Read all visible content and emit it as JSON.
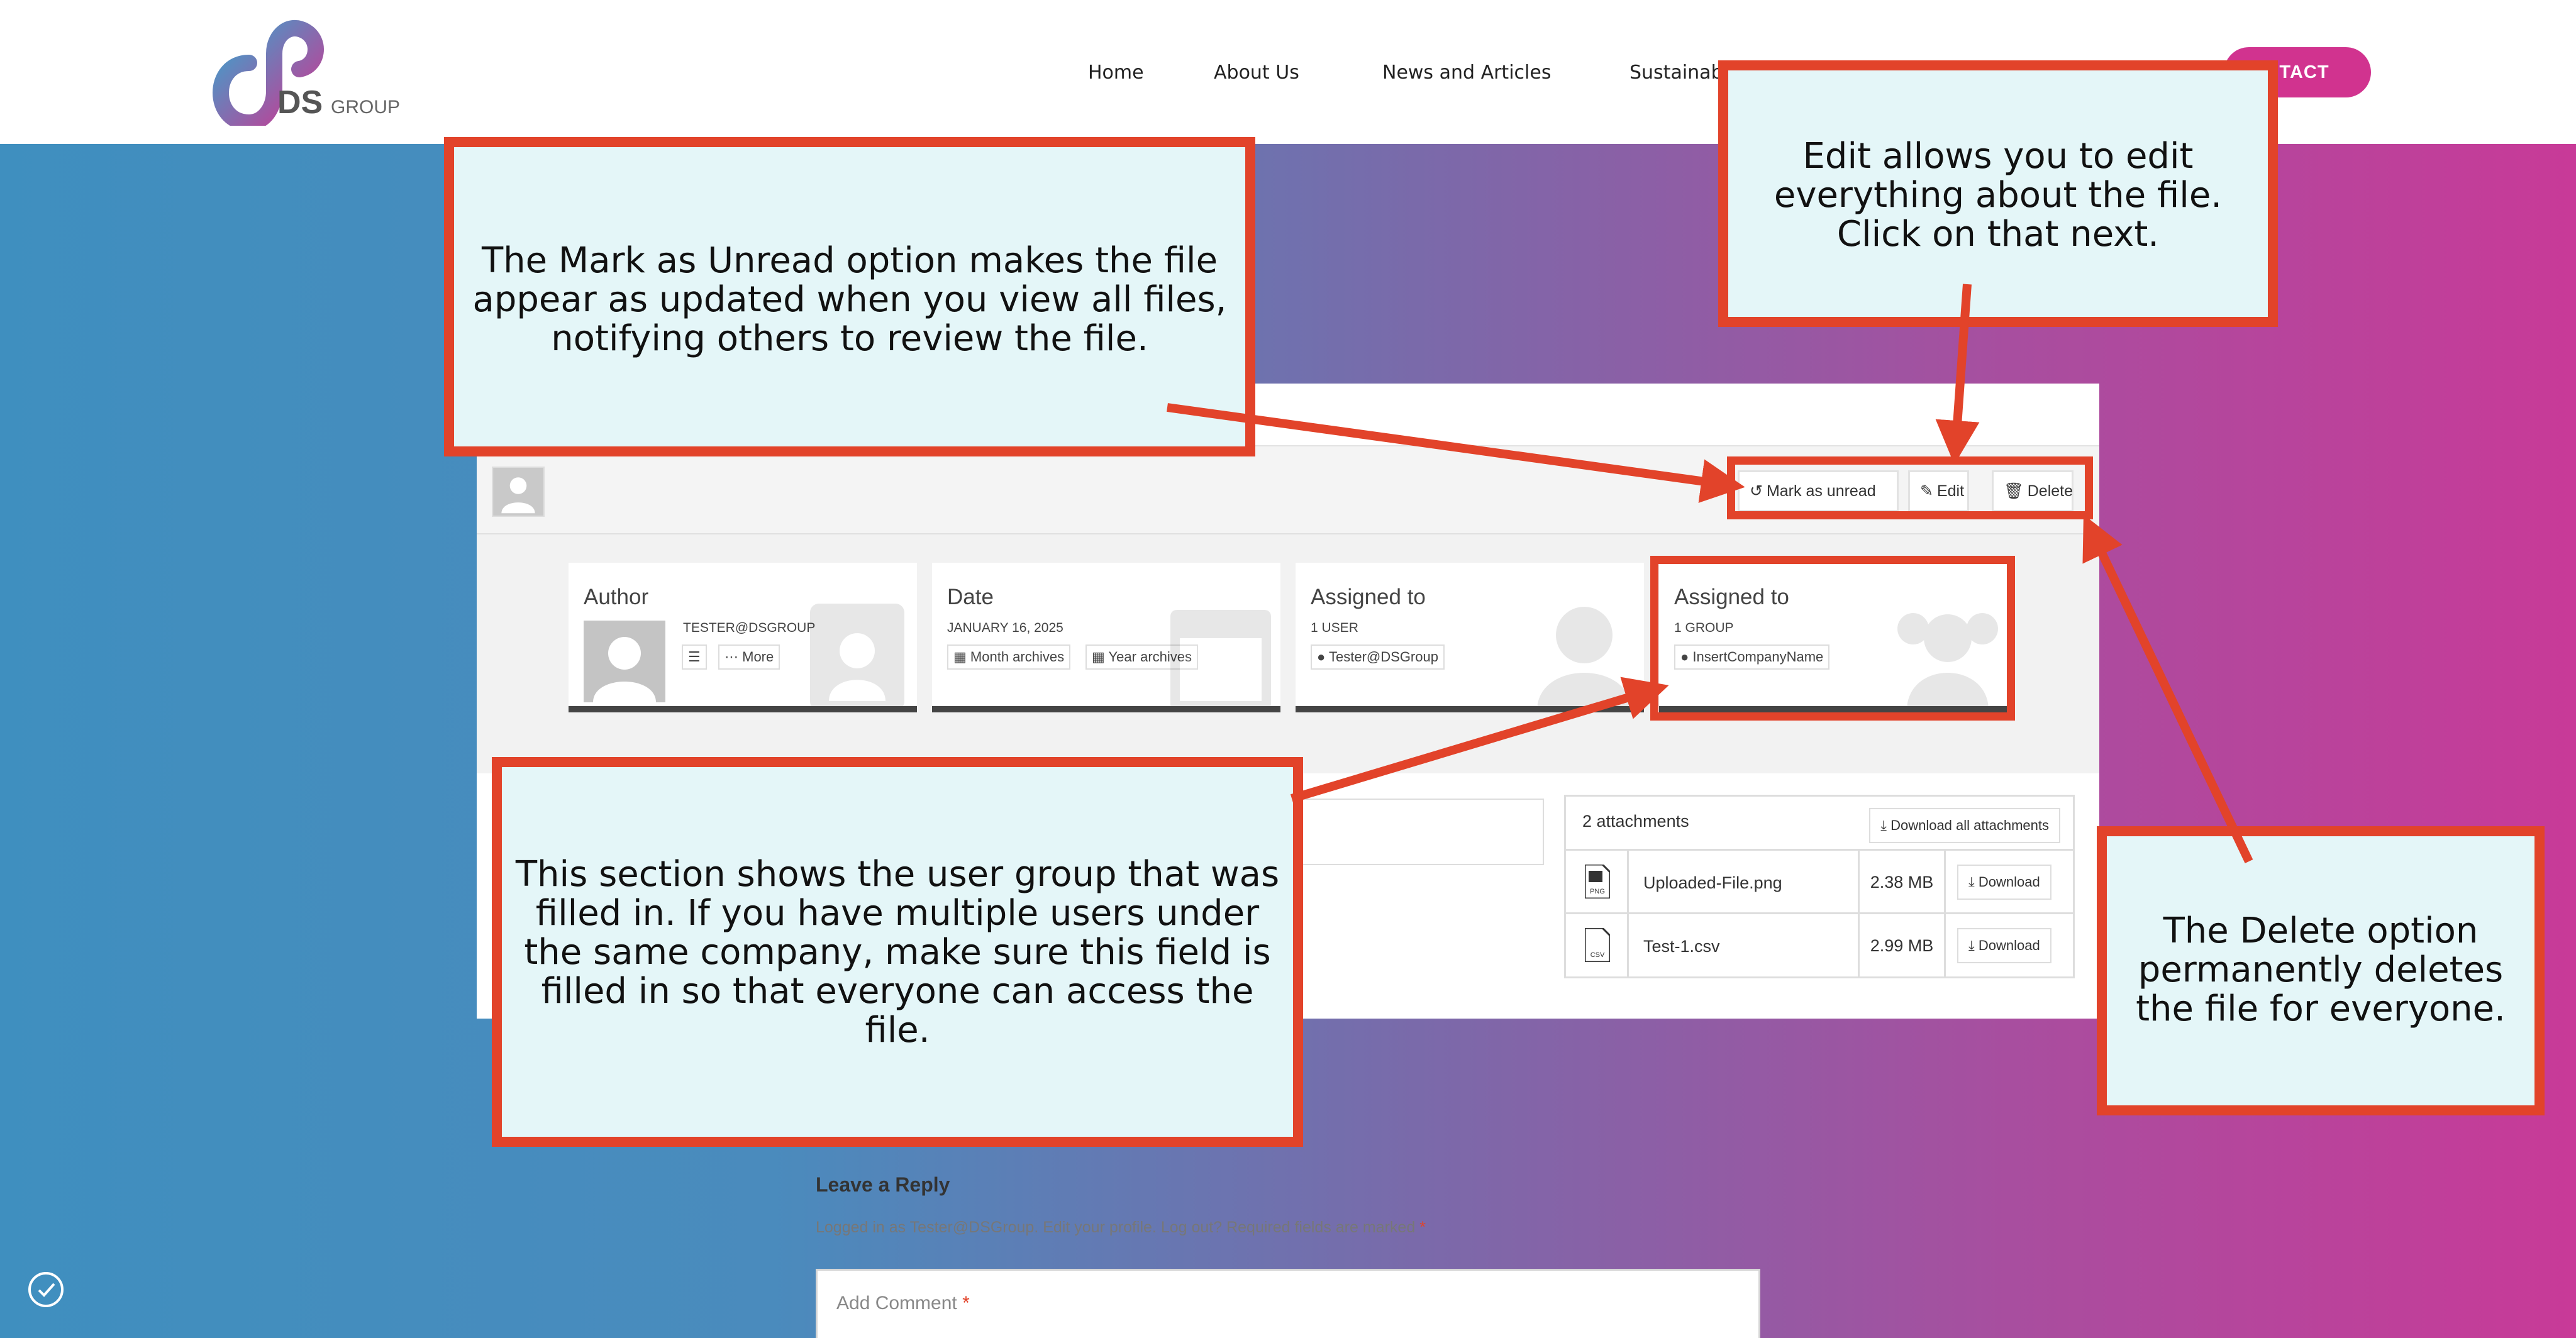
{
  "header": {
    "logo_text": "DS",
    "logo_sub": "GROUP",
    "nav": [
      {
        "label": "Home"
      },
      {
        "label": "About Us"
      },
      {
        "label": "News and Articles"
      },
      {
        "label": "Sustainab"
      }
    ],
    "contact_label": "NTACT"
  },
  "file": {
    "toolbar": {
      "mark_unread": "Mark as unread",
      "edit": "Edit",
      "delete": "Delete"
    },
    "author": {
      "title": "Author",
      "name": "TESTER@DSGROUP",
      "more": "More"
    },
    "date": {
      "title": "Date",
      "value": "JANUARY 16, 2025",
      "month_archives": "Month archives",
      "year_archives": "Year archives"
    },
    "assigned_user": {
      "title": "Assigned to",
      "count": "1 USER",
      "user": "Tester@DSGroup"
    },
    "assigned_group": {
      "title": "Assigned to",
      "count": "1 GROUP",
      "group": "InsertCompanyName"
    },
    "attachments": {
      "header": "2 attachments",
      "download_all": "Download all attachments",
      "items": [
        {
          "name": "Uploaded-File.png",
          "size": "2.38 MB",
          "download": "Download",
          "type": "PNG"
        },
        {
          "name": "Test-1.csv",
          "size": "2.99 MB",
          "download": "Download",
          "type": "CSV"
        }
      ]
    }
  },
  "callouts": {
    "mark_unread": "The Mark as Unread option makes the file appear as updated when you view all files, notifying others to review the file.",
    "edit": "Edit allows you to edit everything about the file. Click on that next.",
    "group": "This section shows the user group that was filled in. If you have multiple users under the same company, make sure this field is filled in so that everyone can access the file.",
    "delete": "The Delete option permanently deletes the file for everyone."
  },
  "reply": {
    "title": "Leave a Reply",
    "note": "Logged in as Tester@DSGroup. Edit your profile. Log out? Required fields are marked",
    "required_mark": "*",
    "comment_placeholder": "Add Comment"
  },
  "colors": {
    "accent_red": "#e2432a",
    "callout_bg": "#e4f6f8",
    "contact_pink": "#d1338f"
  }
}
